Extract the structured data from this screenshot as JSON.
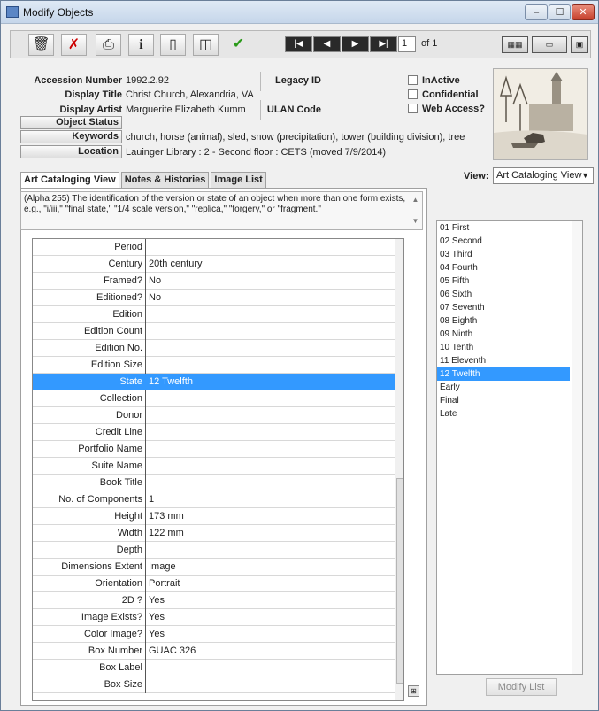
{
  "window": {
    "title": "Modify Objects",
    "minimize": "–",
    "maximize": "☐",
    "close": "✕"
  },
  "toolbar": {
    "icons": [
      "trash-icon",
      "no-edit-icon",
      "print-icon",
      "info-icon",
      "page-icon",
      "copy-icon",
      "check-icon"
    ],
    "glyphs": {
      "trash": "🗑",
      "noedit": "✗",
      "print": "⎙",
      "info": "i",
      "page": "▯",
      "copy": "◫",
      "check": "✔"
    },
    "nav": {
      "first": "|◀",
      "prev": "◀",
      "next": "▶",
      "last": "▶|"
    },
    "record": "1",
    "of": "of 1",
    "right_buttons": [
      "▦▦",
      "▭",
      "▣"
    ]
  },
  "header": {
    "accession_label": "Accession Number",
    "accession_value": "1992.2.92",
    "legacy_label": "Legacy ID",
    "display_title_label": "Display Title",
    "display_title_value": "Christ Church, Alexandria, VA",
    "display_artist_label": "Display Artist",
    "display_artist_value": "Marguerite Elizabeth Kumm",
    "ulan_label": "ULAN Code",
    "object_status_label": "Object Status",
    "keywords_label": "Keywords",
    "keywords_value": "church, horse (animal), sled, snow (precipitation), tower (building division), tree",
    "location_label": "Location",
    "location_value": "Lauinger Library : 2 - Second floor : CETS (moved 7/9/2014)",
    "checks": {
      "inactive": "InActive",
      "confidential": "Confidential",
      "web_access": "Web Access?"
    }
  },
  "tabs": [
    "Art Cataloging View",
    "Notes & Histories",
    "Image List"
  ],
  "view": {
    "label": "View:",
    "selected": "Art Cataloging View",
    "caret": "▼"
  },
  "description": "(Alpha 255) The identification of the version or state of an object when more than one form exists, e.g., \"i/iii,\" \"final state,\" \"1/4 scale version,\" \"replica,\" \"forgery,\" or \"fragment.\"",
  "fields": [
    {
      "label": "Period",
      "value": ""
    },
    {
      "label": "Century",
      "value": "20th century"
    },
    {
      "label": "Framed?",
      "value": "No"
    },
    {
      "label": "Editioned?",
      "value": "No"
    },
    {
      "label": "Edition",
      "value": ""
    },
    {
      "label": "Edition Count",
      "value": ""
    },
    {
      "label": "Edition No.",
      "value": ""
    },
    {
      "label": "Edition Size",
      "value": ""
    },
    {
      "label": "State",
      "value": "12 Twelfth"
    },
    {
      "label": "Collection",
      "value": ""
    },
    {
      "label": "Donor",
      "value": ""
    },
    {
      "label": "Credit Line",
      "value": ""
    },
    {
      "label": "Portfolio Name",
      "value": ""
    },
    {
      "label": "Suite Name",
      "value": ""
    },
    {
      "label": "Book Title",
      "value": ""
    },
    {
      "label": "No. of Components",
      "value": "1"
    },
    {
      "label": "Height",
      "value": "173 mm"
    },
    {
      "label": "Width",
      "value": "122 mm"
    },
    {
      "label": "Depth",
      "value": ""
    },
    {
      "label": "Dimensions Extent",
      "value": "Image"
    },
    {
      "label": "Orientation",
      "value": "Portrait"
    },
    {
      "label": "2D ?",
      "value": "Yes"
    },
    {
      "label": "Image Exists?",
      "value": "Yes"
    },
    {
      "label": "Color Image?",
      "value": "Yes"
    },
    {
      "label": "Box Number",
      "value": "GUAC 326"
    },
    {
      "label": "Box Label",
      "value": ""
    },
    {
      "label": "Box Size",
      "value": ""
    }
  ],
  "selected_field": "State",
  "state_list": [
    "01 First",
    "02 Second",
    "03 Third",
    "04 Fourth",
    "05 Fifth",
    "06 Sixth",
    "07 Seventh",
    "08 Eighth",
    "09 Ninth",
    "10 Tenth",
    "11 Eleventh",
    "12 Twelfth",
    "Early",
    "Final",
    "Late"
  ],
  "state_selected": "12 Twelfth",
  "modify_list": "Modify List"
}
